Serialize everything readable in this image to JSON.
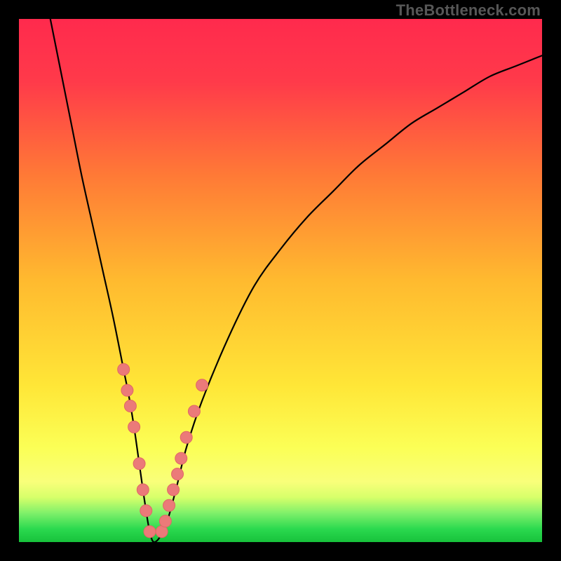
{
  "watermark": {
    "text": "TheBottleneck.com"
  },
  "colors": {
    "black": "#000000",
    "curve": "#000000",
    "marker_fill": "#eb7a79",
    "marker_stroke": "#e06765",
    "grad_top": "#ff2a4d",
    "grad_mid1": "#ff8e2e",
    "grad_mid2": "#ffe637",
    "grad_band": "#f9ff7a",
    "grad_green": "#2bd94f",
    "grad_green_deep": "#17c23b"
  },
  "chart_data": {
    "type": "line",
    "title": "",
    "xlabel": "",
    "ylabel": "",
    "xlim": [
      0,
      100
    ],
    "ylim": [
      0,
      100
    ],
    "grid": false,
    "legend": false,
    "annotations": [],
    "series": [
      {
        "name": "bottleneck-curve",
        "x": [
          6,
          8,
          10,
          12,
          14,
          16,
          18,
          20,
          21,
          22,
          23,
          24,
          25,
          26,
          28,
          30,
          32,
          35,
          40,
          45,
          50,
          55,
          60,
          65,
          70,
          75,
          80,
          85,
          90,
          95,
          100
        ],
        "y": [
          100,
          90,
          80,
          70,
          61,
          52,
          43,
          33,
          28,
          22,
          15,
          8,
          2,
          0,
          3,
          10,
          18,
          27,
          39,
          49,
          56,
          62,
          67,
          72,
          76,
          80,
          83,
          86,
          89,
          91,
          93
        ]
      }
    ],
    "markers": [
      {
        "name": "highlighted-points",
        "points": [
          {
            "x": 20.0,
            "y": 33
          },
          {
            "x": 20.7,
            "y": 29
          },
          {
            "x": 21.3,
            "y": 26
          },
          {
            "x": 22.0,
            "y": 22
          },
          {
            "x": 23.0,
            "y": 15
          },
          {
            "x": 23.7,
            "y": 10
          },
          {
            "x": 24.3,
            "y": 6
          },
          {
            "x": 25.0,
            "y": 2
          },
          {
            "x": 27.3,
            "y": 2
          },
          {
            "x": 28.0,
            "y": 4
          },
          {
            "x": 28.7,
            "y": 7
          },
          {
            "x": 29.5,
            "y": 10
          },
          {
            "x": 30.3,
            "y": 13
          },
          {
            "x": 31.0,
            "y": 16
          },
          {
            "x": 32.0,
            "y": 20
          },
          {
            "x": 33.5,
            "y": 25
          },
          {
            "x": 35.0,
            "y": 30
          }
        ]
      }
    ],
    "background_gradient": {
      "stops": [
        {
          "offset": 0.0,
          "color": "#ff2a4d"
        },
        {
          "offset": 0.12,
          "color": "#ff3a4a"
        },
        {
          "offset": 0.3,
          "color": "#ff7a36"
        },
        {
          "offset": 0.5,
          "color": "#ffba2f"
        },
        {
          "offset": 0.7,
          "color": "#ffe637"
        },
        {
          "offset": 0.82,
          "color": "#fbff56"
        },
        {
          "offset": 0.885,
          "color": "#f9ff7a"
        },
        {
          "offset": 0.915,
          "color": "#d6ff6a"
        },
        {
          "offset": 0.945,
          "color": "#7ef06a"
        },
        {
          "offset": 0.975,
          "color": "#2bd94f"
        },
        {
          "offset": 1.0,
          "color": "#17c23b"
        }
      ]
    }
  }
}
